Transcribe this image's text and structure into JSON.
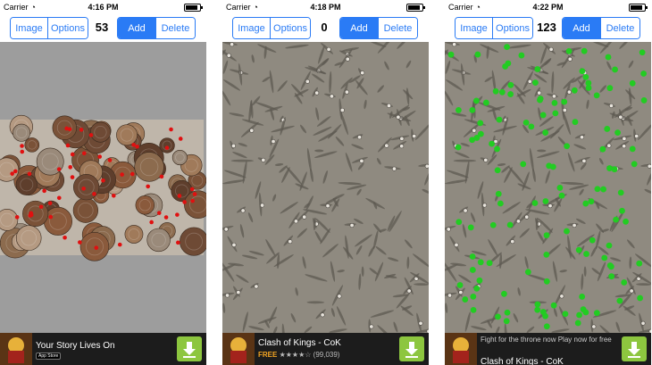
{
  "screens": [
    {
      "status": {
        "carrier": "Carrier",
        "time": "4:16 PM"
      },
      "toolbar": {
        "image": "Image",
        "options": "Options",
        "count": "53",
        "add": "Add",
        "delete": "Delete"
      },
      "ad": {
        "title": "Your Story Lives On",
        "badge": "App Store"
      }
    },
    {
      "status": {
        "carrier": "Carrier",
        "time": "4:18 PM"
      },
      "toolbar": {
        "image": "Image",
        "options": "Options",
        "count": "0",
        "add": "Add",
        "delete": "Delete"
      },
      "ad": {
        "title": "Clash of Kings - CoK",
        "price": "FREE",
        "rating_count": "(99,039)",
        "rating": 4.5
      }
    },
    {
      "status": {
        "carrier": "Carrier",
        "time": "4:22 PM"
      },
      "toolbar": {
        "image": "Image",
        "options": "Options",
        "count": "123",
        "add": "Add",
        "delete": "Delete"
      },
      "ad": {
        "tagline": "Fight for the throne now Play now for free",
        "title": "Clash of Kings - CoK"
      }
    }
  ],
  "colors": {
    "accent": "#2a7bf5",
    "coin_marker": "#e01010",
    "cell_marker": "#22cc22",
    "download": "#8dc63f"
  },
  "icons": {
    "wifi": "wifi-icon",
    "battery": "battery-icon",
    "download": "download-icon"
  }
}
